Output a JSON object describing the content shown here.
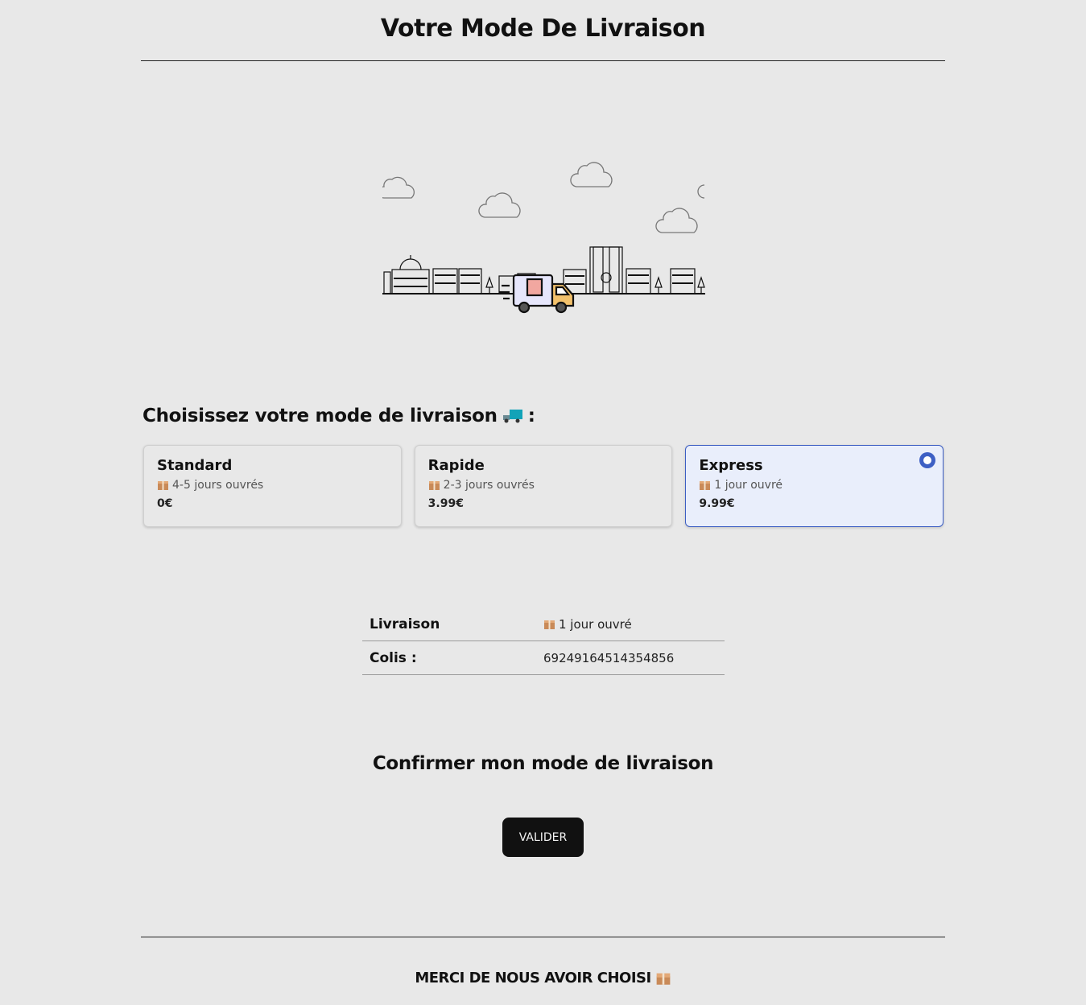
{
  "header": {
    "title": "Votre Mode De Livraison"
  },
  "delivery": {
    "heading": "Choisissez votre mode de livraison",
    "heading_suffix": ":",
    "options": [
      {
        "name": "Standard",
        "days": "4-5 jours ouvrés",
        "price": "0€",
        "selected": false
      },
      {
        "name": "Rapide",
        "days": "2-3 jours ouvrés",
        "price": "3.99€",
        "selected": false
      },
      {
        "name": "Express",
        "days": "1 jour ouvré",
        "price": "9.99€",
        "selected": true
      }
    ]
  },
  "summary": {
    "rows": [
      {
        "label": "Livraison",
        "value": "1 jour ouvré",
        "icon": "gift-icon"
      },
      {
        "label": "Colis :",
        "value": "69249164514354856"
      }
    ]
  },
  "confirm": {
    "heading": "Confirmer mon mode de livraison",
    "button_label": "VALIDER"
  },
  "footer": {
    "text": "MERCI DE NOUS AVOIR CHOISI"
  },
  "colors": {
    "accent": "#3d5fc4",
    "selected_bg": "#e9eefb",
    "button_bg": "#111111",
    "page_bg": "#e8e8e8"
  }
}
